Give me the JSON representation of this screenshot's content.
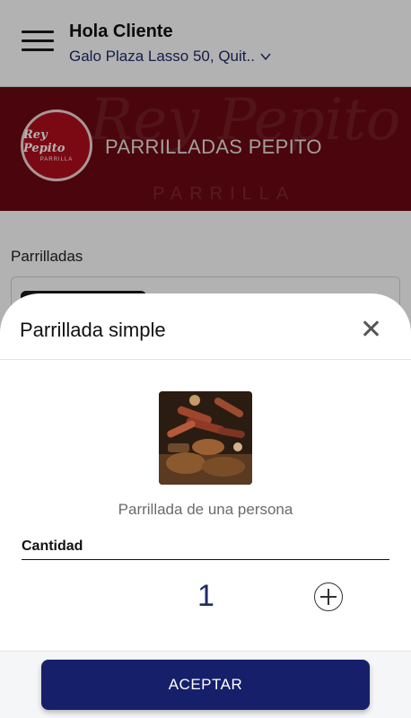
{
  "header": {
    "greeting": "Hola Cliente",
    "address": "Galo Plaza Lasso 50, Quit..",
    "menu_icon": "hamburger-menu-icon",
    "chevron_icon": "chevron-down-icon"
  },
  "restaurant": {
    "name": "PARRILLADAS PEPITO",
    "logo_text": "Rey Pepito",
    "logo_subtext": "PARRILLA",
    "banner_text": "Rey Pepito",
    "banner_subtext": "PARRILLA",
    "banner_color": "#6b0a12"
  },
  "menu": {
    "category": "Parrilladas"
  },
  "modal": {
    "title": "Parrillada simple",
    "close_icon": "close-icon",
    "description": "Parrillada de una persona",
    "quantity_label": "Cantidad",
    "quantity_value": "1",
    "increment_icon": "plus-circle-icon",
    "accept_label": "ACEPTAR",
    "accent_color": "#16206a"
  }
}
